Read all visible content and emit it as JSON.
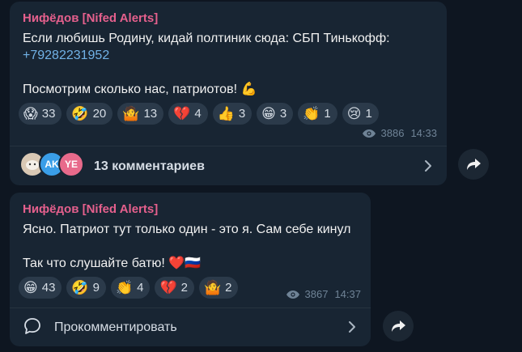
{
  "messages": [
    {
      "author": "Нифёдов [Nifed Alerts]",
      "line1": "Если любишь Родину, кидай полтиник сюда: СБП Тинькофф:",
      "phone": "+79282231952",
      "line3": "Посмотрим сколько нас, патриотов! 💪",
      "reactions": [
        {
          "emoji": "😱",
          "count": "33"
        },
        {
          "emoji": "🤣",
          "count": "20"
        },
        {
          "emoji": "🤷",
          "count": "13"
        },
        {
          "emoji": "💔",
          "count": "4"
        },
        {
          "emoji": "👍",
          "count": "3"
        },
        {
          "emoji": "😁",
          "count": "3"
        },
        {
          "emoji": "👏",
          "count": "1"
        },
        {
          "emoji": "😢",
          "count": "1"
        }
      ],
      "views": "3886",
      "time": "14:33",
      "avatars": [
        {
          "initials": "",
          "color": "#d9c8b4"
        },
        {
          "initials": "AK",
          "color": "#3a9ee8"
        },
        {
          "initials": "YE",
          "color": "#e86a8b"
        }
      ],
      "comments_label": "13 комментариев"
    },
    {
      "author": "Нифёдов [Nifed Alerts]",
      "line1": "Ясно. Патриот тут только один - это я. Сам себе кинул",
      "line3": "Так что слушайте батю! ❤️🇷🇺",
      "reactions": [
        {
          "emoji": "😁",
          "count": "43"
        },
        {
          "emoji": "🤣",
          "count": "9"
        },
        {
          "emoji": "👏",
          "count": "4"
        },
        {
          "emoji": "💔",
          "count": "2"
        },
        {
          "emoji": "🤷",
          "count": "2"
        }
      ],
      "views": "3867",
      "time": "14:37",
      "comments_label": "Прокомментировать"
    }
  ],
  "icons": {
    "views": "eye-icon",
    "share": "share-icon",
    "chevron": "chevron-right-icon",
    "comment": "comment-bubble-icon"
  },
  "colors": {
    "background": "#0e1621",
    "bubble": "#182533",
    "author": "#e5608d",
    "link": "#71b2e6",
    "reaction_bg": "#2b3a4a"
  }
}
